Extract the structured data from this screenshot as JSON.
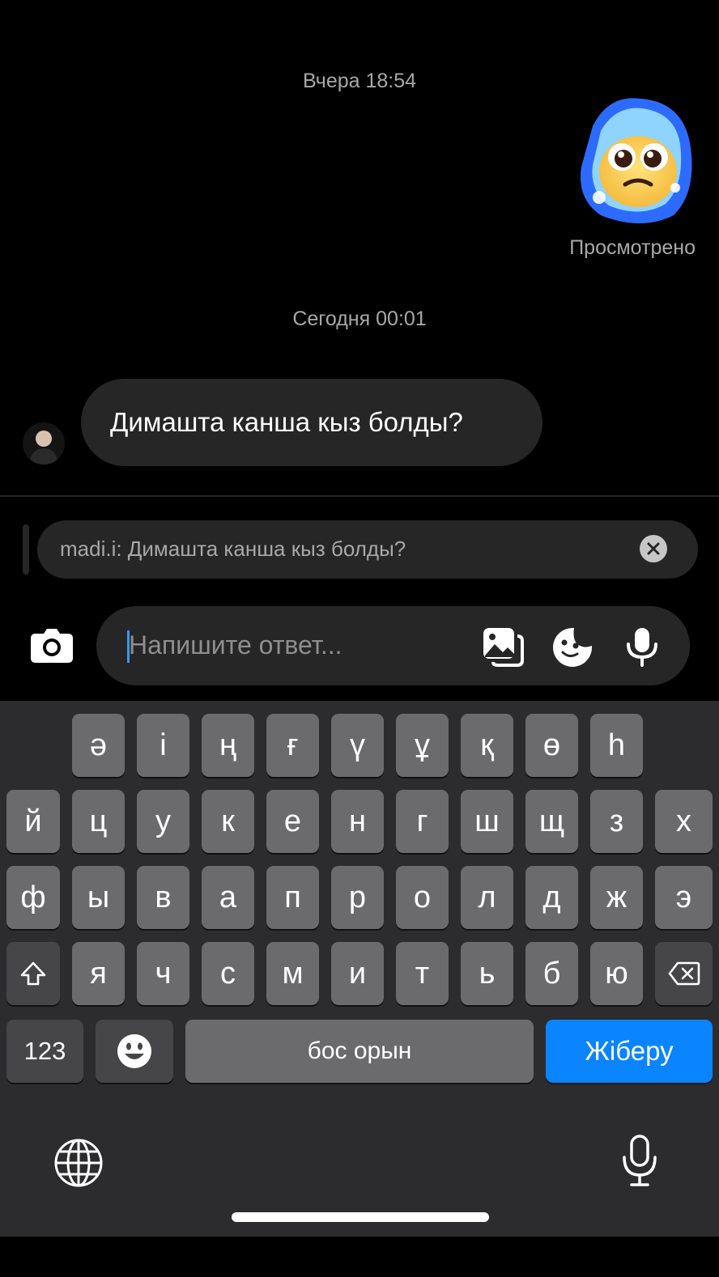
{
  "chat": {
    "timestamp_1": "Вчера 18:54",
    "seen_label": "Просмотрено",
    "timestamp_2": "Сегодня 00:01",
    "incoming_message": "Димашта канша кыз болды?"
  },
  "reply": {
    "preview_text": "madi.i: Димашта канша кыз болды?"
  },
  "composer": {
    "placeholder": "Напишите ответ..."
  },
  "keyboard": {
    "row1": [
      "ә",
      "і",
      "ң",
      "ғ",
      "ү",
      "ұ",
      "қ",
      "ө",
      "һ"
    ],
    "row2": [
      "й",
      "ц",
      "у",
      "к",
      "е",
      "н",
      "г",
      "ш",
      "щ",
      "з",
      "х"
    ],
    "row3": [
      "ф",
      "ы",
      "в",
      "а",
      "п",
      "р",
      "о",
      "л",
      "д",
      "ж",
      "э"
    ],
    "row4": [
      "я",
      "ч",
      "с",
      "м",
      "и",
      "т",
      "ь",
      "б",
      "ю"
    ],
    "numbers_label": "123",
    "space_label": "бос орын",
    "send_label": "Жіберу"
  },
  "colors": {
    "background": "#000000",
    "bubble": "#262626",
    "accent_blue": "#0a84ff",
    "key": "#6b6b6d",
    "key_dark": "#464649"
  },
  "icons": [
    "camera-icon",
    "gallery-icon",
    "sticker-icon",
    "microphone-icon",
    "close-icon",
    "shift-icon",
    "backspace-icon",
    "emoji-icon",
    "globe-icon"
  ]
}
